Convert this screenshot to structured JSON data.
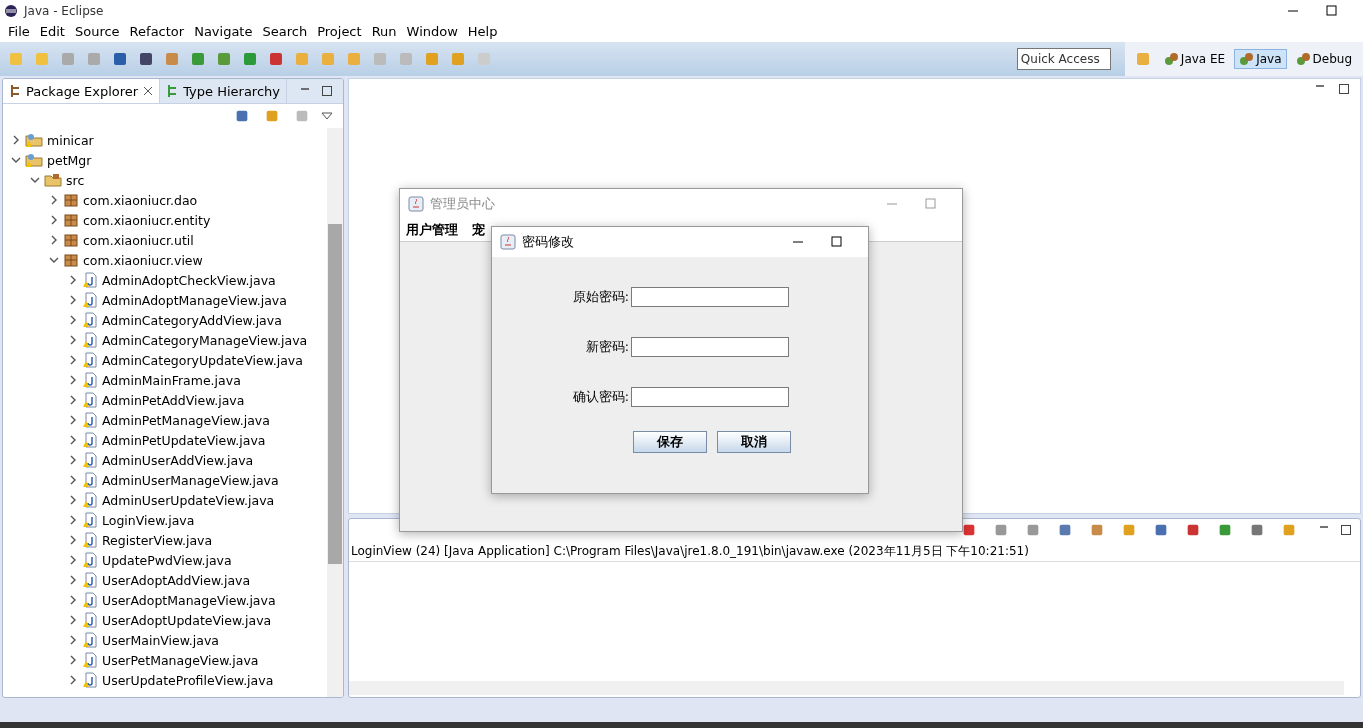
{
  "window": {
    "title": "Java - Eclipse"
  },
  "menu": [
    "File",
    "Edit",
    "Source",
    "Refactor",
    "Navigate",
    "Search",
    "Project",
    "Run",
    "Window",
    "Help"
  ],
  "quick_access": {
    "placeholder": "Quick Access"
  },
  "perspectives": [
    {
      "label": "Java EE",
      "selected": false
    },
    {
      "label": "Java",
      "selected": true
    },
    {
      "label": "Debug",
      "selected": false
    }
  ],
  "left_tabs": [
    {
      "label": "Package Explorer",
      "selected": true
    },
    {
      "label": "Type Hierarchy",
      "selected": false
    }
  ],
  "tree": [
    {
      "kind": "project",
      "label": "minicar",
      "expanded": false
    },
    {
      "kind": "project",
      "label": "petMgr",
      "expanded": true,
      "children": [
        {
          "kind": "source-folder",
          "label": "src",
          "expanded": true,
          "children": [
            {
              "kind": "package",
              "label": "com.xiaoniucr.dao",
              "expanded": false
            },
            {
              "kind": "package",
              "label": "com.xiaoniucr.entity",
              "expanded": false
            },
            {
              "kind": "package",
              "label": "com.xiaoniucr.util",
              "expanded": false
            },
            {
              "kind": "package",
              "label": "com.xiaoniucr.view",
              "expanded": true,
              "children": [
                {
                  "kind": "file",
                  "label": "AdminAdoptCheckView.java",
                  "expanded": false
                },
                {
                  "kind": "file",
                  "label": "AdminAdoptManageView.java",
                  "expanded": false
                },
                {
                  "kind": "file",
                  "label": "AdminCategoryAddView.java",
                  "expanded": false
                },
                {
                  "kind": "file",
                  "label": "AdminCategoryManageView.java",
                  "expanded": false
                },
                {
                  "kind": "file",
                  "label": "AdminCategoryUpdateView.java",
                  "expanded": false
                },
                {
                  "kind": "file",
                  "label": "AdminMainFrame.java",
                  "expanded": false
                },
                {
                  "kind": "file",
                  "label": "AdminPetAddView.java",
                  "expanded": false
                },
                {
                  "kind": "file",
                  "label": "AdminPetManageView.java",
                  "expanded": false
                },
                {
                  "kind": "file",
                  "label": "AdminPetUpdateView.java",
                  "expanded": false
                },
                {
                  "kind": "file",
                  "label": "AdminUserAddView.java",
                  "expanded": false
                },
                {
                  "kind": "file",
                  "label": "AdminUserManageView.java",
                  "expanded": false
                },
                {
                  "kind": "file",
                  "label": "AdminUserUpdateView.java",
                  "expanded": false
                },
                {
                  "kind": "file",
                  "label": "LoginView.java",
                  "expanded": false
                },
                {
                  "kind": "file",
                  "label": "RegisterView.java",
                  "expanded": false
                },
                {
                  "kind": "file",
                  "label": "UpdatePwdView.java",
                  "expanded": false
                },
                {
                  "kind": "file",
                  "label": "UserAdoptAddView.java",
                  "expanded": false
                },
                {
                  "kind": "file",
                  "label": "UserAdoptManageView.java",
                  "expanded": false
                },
                {
                  "kind": "file",
                  "label": "UserAdoptUpdateView.java",
                  "expanded": false
                },
                {
                  "kind": "file",
                  "label": "UserMainView.java",
                  "expanded": false
                },
                {
                  "kind": "file",
                  "label": "UserPetManageView.java",
                  "expanded": false
                },
                {
                  "kind": "file",
                  "label": "UserUpdateProfileView.java",
                  "expanded": false
                }
              ]
            }
          ]
        }
      ]
    }
  ],
  "console_line": "LoginView (24) [Java Application] C:\\Program Files\\Java\\jre1.8.0_191\\bin\\javaw.exe (2023年11月5日 下午10:21:51)",
  "admin_frame": {
    "title": "管理员中心",
    "menu": [
      "用户管理",
      "宠"
    ]
  },
  "dialog": {
    "title": "密码修改",
    "fields": [
      {
        "label": "原始密码:"
      },
      {
        "label": "新密码:"
      },
      {
        "label": "确认密码:"
      }
    ],
    "buttons": [
      "保存",
      "取消"
    ]
  }
}
